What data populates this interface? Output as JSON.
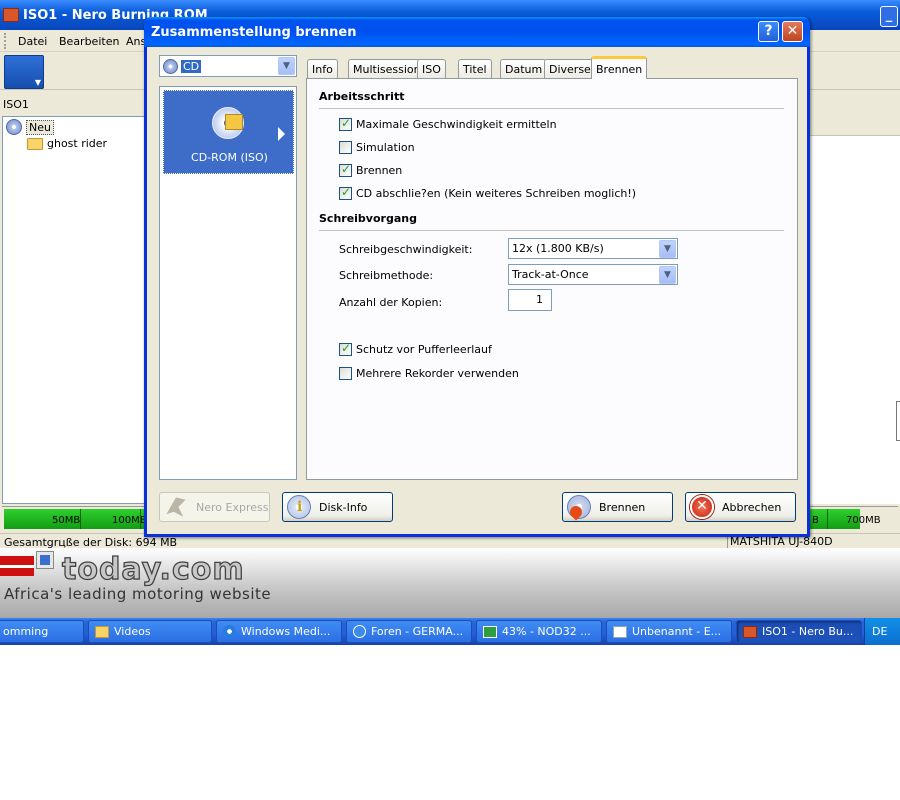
{
  "main_window": {
    "title": "ISO1 - Nero Burning ROM",
    "min_glyph": "_",
    "menu": [
      "Datei",
      "Bearbeiten",
      "Ans"
    ],
    "iso_label": "ISO1",
    "tree": {
      "root": "Neu",
      "child": "ghost rider"
    },
    "capacity": {
      "left_labels": [
        "50MB",
        "100MB"
      ],
      "right_labels": [
        "B",
        "700MB"
      ]
    },
    "status": {
      "disk_size": "Gesamtgrцße der Disk: 694 MB",
      "recorder": "MATSHITA UJ-840D"
    }
  },
  "banner": {
    "logo_text": "today.com",
    "tagline": "Africa's leading motoring website"
  },
  "taskbar": {
    "items": [
      {
        "label": "omming",
        "icon": "none"
      },
      {
        "label": "Videos",
        "icon": "folder-icon"
      },
      {
        "label": "Windows Medi...",
        "icon": "media-player-icon"
      },
      {
        "label": "Foren - GERMA...",
        "icon": "internet-explorer-icon"
      },
      {
        "label": "43% - NOD32 ...",
        "icon": "nod32-icon"
      },
      {
        "label": "Unbenannt - E...",
        "icon": "document-icon"
      },
      {
        "label": "ISO1 - Nero Bu...",
        "icon": "nero-icon",
        "active": true
      }
    ],
    "tray_lang": "DE"
  },
  "dialog": {
    "title": "Zusammenstellung brennen",
    "help_glyph": "?",
    "close_glyph": "✕",
    "disc_type": "CD",
    "project_type": "CD-ROM (ISO)",
    "tabs": [
      "Info",
      "Multisession",
      "ISO",
      "Titel",
      "Datum",
      "Diverse",
      "Brennen"
    ],
    "active_tab": "Brennen",
    "arbeitsschritt": {
      "heading": "Arbeitsschritt",
      "options": [
        {
          "label": "Maximale Geschwindigkeit ermitteln",
          "checked": true
        },
        {
          "label": "Simulation",
          "checked": false
        },
        {
          "label": "Brennen",
          "checked": true
        },
        {
          "label": "CD abschlie?en (Kein weiteres Schreiben moglich!)",
          "checked": true
        }
      ]
    },
    "schreibvorgang": {
      "heading": "Schreibvorgang",
      "speed_label": "Schreibgeschwindigkeit:",
      "speed_value": "12x (1.800 KB/s)",
      "method_label": "Schreibmethode:",
      "method_value": "Track-at-Once",
      "copies_label": "Anzahl der Kopien:",
      "copies_value": "1",
      "options": [
        {
          "label": "Schutz vor Pufferleerlauf",
          "checked": true
        },
        {
          "label": "Mehrere Rekorder verwenden",
          "checked": false
        }
      ]
    },
    "buttons": {
      "nero_express": "Nero Express",
      "disk_info": "Disk-Info",
      "burn": "Brennen",
      "cancel": "Abbrechen"
    }
  }
}
